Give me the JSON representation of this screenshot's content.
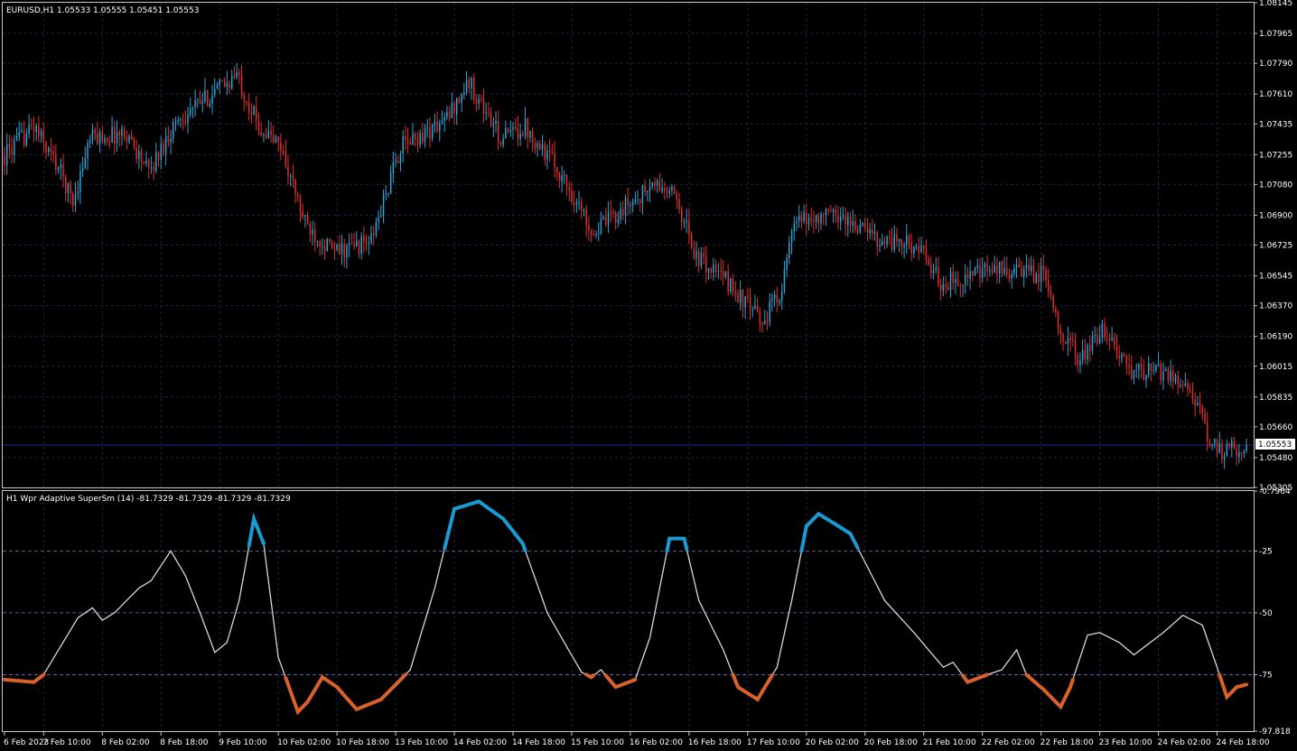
{
  "colors": {
    "background": "#000000",
    "grid": "#1c2340",
    "frame": "#c8c8c8",
    "bull": "#2ea3d6",
    "bear": "#e0302c",
    "osc_line": "#d8d8d8",
    "osc_high": "#1a9ad0",
    "osc_low": "#d8622a",
    "level": "#7a6cc8",
    "price_line": "#1d2a8a"
  },
  "price_panel": {
    "header": "EURUSD,H1  1.05533 1.05555 1.05451 1.05553",
    "current_price_label": "1.05553"
  },
  "oscillator_panel": {
    "header": "H1 Wpr Adaptive SuperSm (14) -81.7329 -81.7329 -81.7329 -81.7329"
  },
  "chart_data": [
    {
      "type": "candlestick",
      "symbol": "EURUSD",
      "timeframe": "H1",
      "ylim": [
        1.05305,
        1.08145
      ],
      "y_ticks": [
        "1.08145",
        "1.07965",
        "1.07790",
        "1.07610",
        "1.07435",
        "1.07255",
        "1.07080",
        "1.06900",
        "1.06725",
        "1.06545",
        "1.06370",
        "1.06190",
        "1.06015",
        "1.05835",
        "1.05660",
        "1.05480",
        "1.05305"
      ],
      "last_price": 1.05553,
      "grid": true,
      "anchors": [
        [
          0,
          1.0725
        ],
        [
          12,
          1.0742
        ],
        [
          22,
          1.0718
        ],
        [
          28,
          1.0698
        ],
        [
          35,
          1.0735
        ],
        [
          50,
          1.0738
        ],
        [
          59,
          1.0715
        ],
        [
          70,
          1.0745
        ],
        [
          95,
          1.0772
        ],
        [
          104,
          1.0742
        ],
        [
          113,
          1.073
        ],
        [
          123,
          1.0685
        ],
        [
          135,
          1.0668
        ],
        [
          150,
          1.0675
        ],
        [
          162,
          1.073
        ],
        [
          180,
          1.0745
        ],
        [
          190,
          1.0768
        ],
        [
          203,
          1.0735
        ],
        [
          213,
          1.0742
        ],
        [
          225,
          1.072
        ],
        [
          241,
          1.068
        ],
        [
          254,
          1.0695
        ],
        [
          266,
          1.0708
        ],
        [
          275,
          1.07
        ],
        [
          283,
          1.0665
        ],
        [
          295,
          1.0652
        ],
        [
          310,
          1.0627
        ],
        [
          318,
          1.0648
        ],
        [
          323,
          1.0685
        ],
        [
          336,
          1.069
        ],
        [
          341,
          1.069
        ],
        [
          358,
          1.0676
        ],
        [
          373,
          1.0672
        ],
        [
          383,
          1.065
        ],
        [
          405,
          1.0658
        ],
        [
          425,
          1.0655
        ],
        [
          433,
          1.062
        ],
        [
          440,
          1.0605
        ],
        [
          450,
          1.0623
        ],
        [
          460,
          1.0598
        ],
        [
          474,
          1.0598
        ],
        [
          485,
          1.059
        ],
        [
          492,
          1.056
        ],
        [
          497,
          1.0552
        ],
        [
          508,
          1.0554
        ]
      ]
    },
    {
      "type": "line",
      "name": "Wpr Adaptive SuperSm (14)",
      "ylim": [
        -97.818,
        -0.7964
      ],
      "y_ticks": [
        "-0.7964",
        "-25",
        "-50",
        "-75",
        "-97.818"
      ],
      "levels": [
        -25,
        -50,
        -75
      ],
      "high_threshold": -25,
      "low_threshold": -75,
      "points": [
        [
          0,
          -77
        ],
        [
          12,
          -78
        ],
        [
          16,
          -75
        ],
        [
          30,
          -52
        ],
        [
          36,
          -48
        ],
        [
          40,
          -53
        ],
        [
          45,
          -50
        ],
        [
          55,
          -40
        ],
        [
          60,
          -37
        ],
        [
          68,
          -25
        ],
        [
          74,
          -35
        ],
        [
          80,
          -50
        ],
        [
          86,
          -66
        ],
        [
          91,
          -62
        ],
        [
          96,
          -45
        ],
        [
          102,
          -12
        ],
        [
          106,
          -22
        ],
        [
          112,
          -68
        ],
        [
          120,
          -90
        ],
        [
          124,
          -86
        ],
        [
          130,
          -76
        ],
        [
          136,
          -80
        ],
        [
          144,
          -89
        ],
        [
          154,
          -85
        ],
        [
          166,
          -73
        ],
        [
          176,
          -40
        ],
        [
          184,
          -8
        ],
        [
          194,
          -5
        ],
        [
          204,
          -12
        ],
        [
          212,
          -22
        ],
        [
          222,
          -50
        ],
        [
          236,
          -74
        ],
        [
          240,
          -76
        ],
        [
          244,
          -73
        ],
        [
          250,
          -80
        ],
        [
          258,
          -77
        ],
        [
          264,
          -60
        ],
        [
          272,
          -20
        ],
        [
          278,
          -20
        ],
        [
          284,
          -45
        ],
        [
          294,
          -65
        ],
        [
          300,
          -80
        ],
        [
          308,
          -85
        ],
        [
          316,
          -72
        ],
        [
          322,
          -45
        ],
        [
          328,
          -15
        ],
        [
          333,
          -10
        ],
        [
          346,
          -18
        ],
        [
          360,
          -45
        ],
        [
          372,
          -58
        ],
        [
          378,
          -65
        ],
        [
          384,
          -72
        ],
        [
          388,
          -70
        ],
        [
          394,
          -78
        ],
        [
          402,
          -75
        ],
        [
          408,
          -73
        ],
        [
          414,
          -65
        ],
        [
          418,
          -75
        ],
        [
          425,
          -81
        ],
        [
          432,
          -88
        ],
        [
          436,
          -80
        ],
        [
          443,
          -59
        ],
        [
          448,
          -58
        ],
        [
          456,
          -62
        ],
        [
          462,
          -67
        ],
        [
          474,
          -58
        ],
        [
          482,
          -51
        ],
        [
          490,
          -55
        ],
        [
          496,
          -72
        ],
        [
          500,
          -84
        ],
        [
          504,
          -80
        ],
        [
          508,
          -79
        ]
      ]
    }
  ],
  "x_axis": {
    "labels": [
      "6 Feb 2023",
      "7 Feb 10:00",
      "8 Feb 02:00",
      "8 Feb 18:00",
      "9 Feb 10:00",
      "10 Feb 02:00",
      "10 Feb 18:00",
      "13 Feb 10:00",
      "14 Feb 02:00",
      "14 Feb 18:00",
      "15 Feb 10:00",
      "16 Feb 02:00",
      "16 Feb 18:00",
      "17 Feb 10:00",
      "20 Feb 02:00",
      "20 Feb 18:00",
      "21 Feb 10:00",
      "22 Feb 02:00",
      "22 Feb 18:00",
      "23 Feb 10:00",
      "24 Feb 02:00",
      "24 Feb 18:00"
    ]
  }
}
